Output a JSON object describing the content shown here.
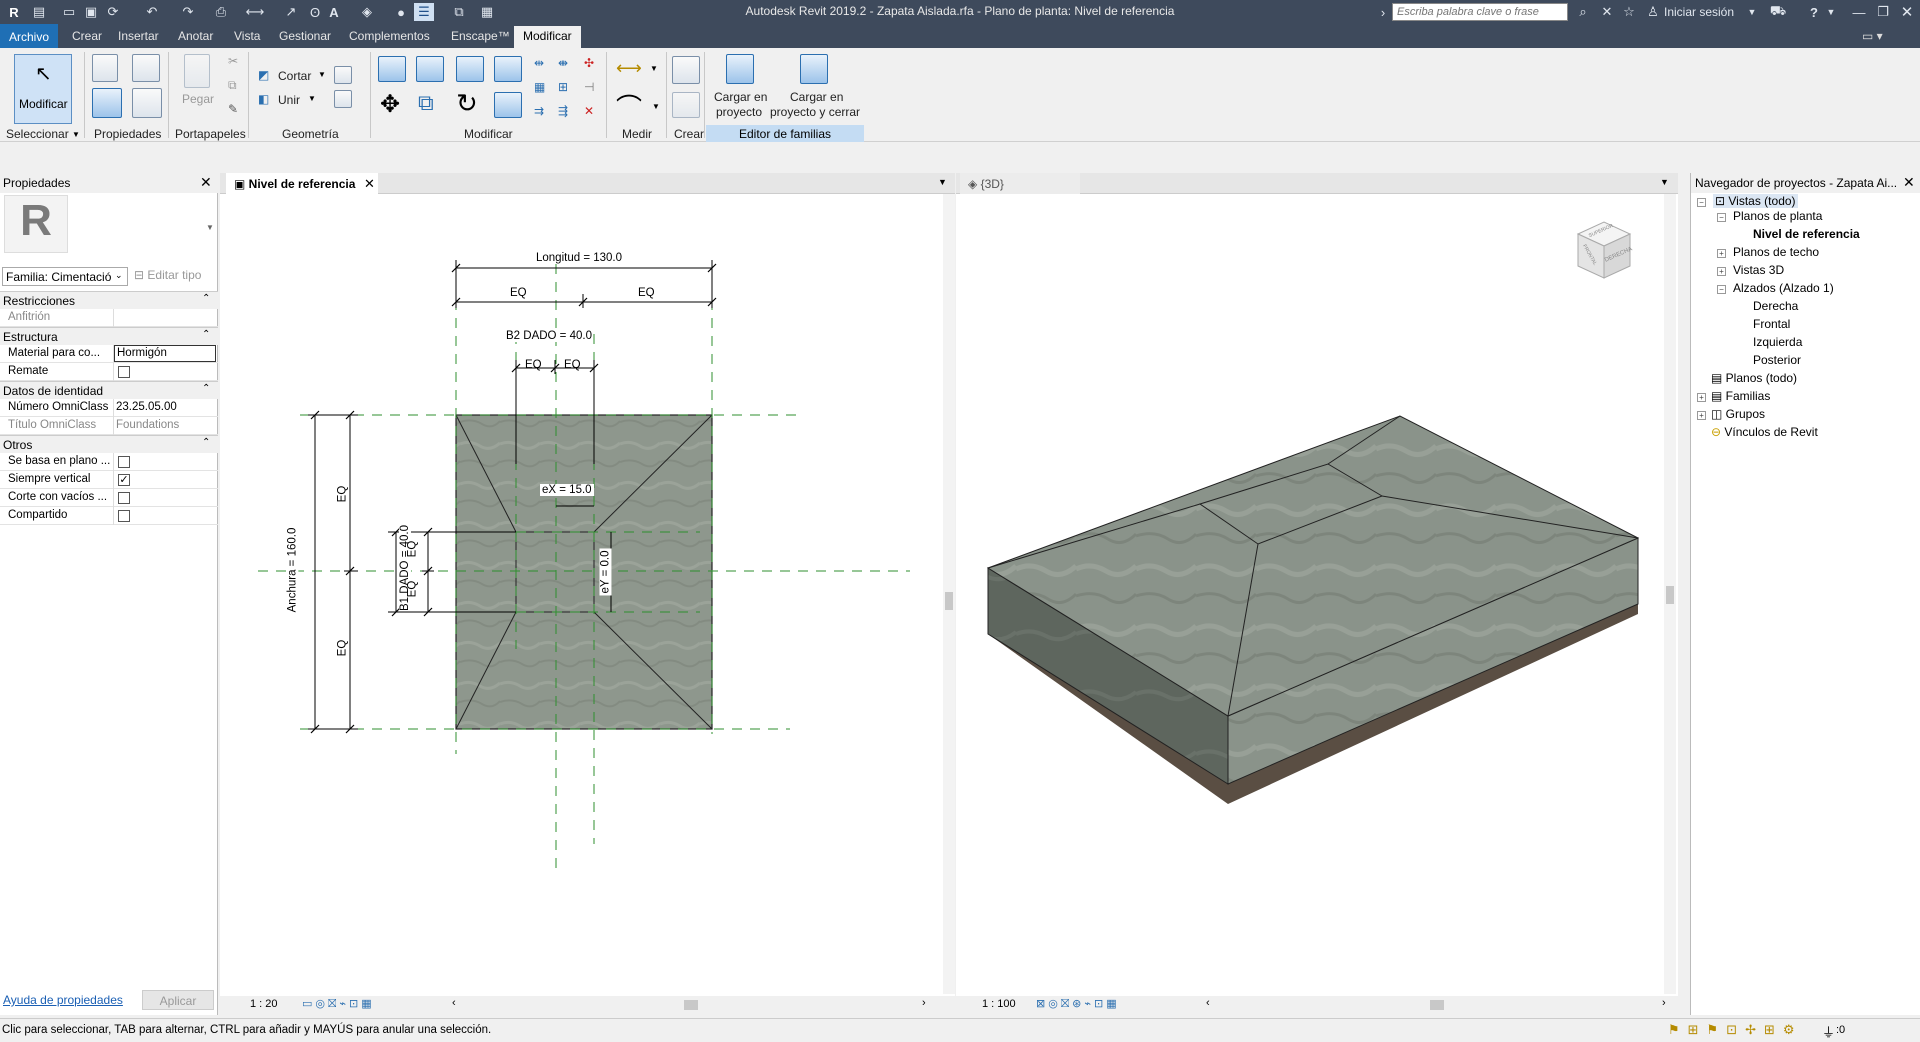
{
  "window": {
    "title": "Autodesk Revit 2019.2 - Zapata Aislada.rfa - Plano de planta: Nivel de referencia"
  },
  "search": {
    "placeholder": "Escriba palabra clave o frase"
  },
  "account": {
    "signin": "Iniciar sesión"
  },
  "menu": {
    "file": "Archivo",
    "items": [
      "Crear",
      "Insertar",
      "Anotar",
      "Vista",
      "Gestionar",
      "Complementos",
      "Enscape™",
      "Modificar"
    ]
  },
  "ribbon": {
    "modify_button": "Modificar",
    "select_label": "Seleccionar",
    "properties_label": "Propiedades",
    "paste_label": "Pegar",
    "clipboard_label": "Portapapeles",
    "cut_label": "Cortar",
    "join_label": "Unir",
    "geometry_label": "Geometría",
    "modify_panel_label": "Modificar",
    "measure_label": "Medir",
    "create_label": "Crear",
    "load_project_1": "Cargar en",
    "load_project_2": "proyecto",
    "load_close_1": "Cargar en",
    "load_close_2": "proyecto y cerrar",
    "family_editor_label": "Editor de familias"
  },
  "properties": {
    "title": "Propiedades",
    "family_selector": "Familia: Cimentació",
    "edit_type": "Editar tipo",
    "groups": [
      {
        "name": "Restricciones",
        "rows": [
          {
            "k": "Anfitrión",
            "v": "",
            "gray": true
          }
        ]
      },
      {
        "name": "Estructura",
        "rows": [
          {
            "k": "Material para co...",
            "v": "Hormigón",
            "boxed": true
          },
          {
            "k": "Remate",
            "v": "",
            "checkbox": false
          }
        ]
      },
      {
        "name": "Datos de identidad",
        "rows": [
          {
            "k": "Número OmniClass",
            "v": "23.25.05.00"
          },
          {
            "k": "Título OmniClass",
            "v": "Foundations",
            "gray": true
          }
        ]
      },
      {
        "name": "Otros",
        "rows": [
          {
            "k": "Se basa en plano ...",
            "checkbox": false
          },
          {
            "k": "Siempre vertical",
            "checkbox": true
          },
          {
            "k": "Corte con vacíos ...",
            "checkbox": false
          },
          {
            "k": "Compartido",
            "checkbox": false
          }
        ]
      }
    ],
    "help_link": "Ayuda de propiedades",
    "apply_button": "Aplicar"
  },
  "view_plan": {
    "tab": "Nivel de referencia",
    "scale": "1 : 20",
    "dims": {
      "longitud": "Longitud = 130.0",
      "eq": "EQ",
      "b2": "B2 DADO = 40.0",
      "anchura": "Anchura = 160.0",
      "b1": "B1 DADO = 40.0",
      "ex": "eX = 15.0",
      "ey": "eY = 0.0"
    }
  },
  "view_3d": {
    "tab": "{3D}",
    "scale": "1 : 100",
    "cube_top": "SUPERIOR",
    "cube_front": "FRONTAL",
    "cube_right": "DERECHA"
  },
  "navigator": {
    "title": "Navegador de proyectos - Zapata Ai...",
    "items": [
      {
        "label": "Vistas (todo)",
        "level": 0,
        "toggle": "-"
      },
      {
        "label": "Planos de planta",
        "level": 1,
        "toggle": "-"
      },
      {
        "label": "Nivel de referencia",
        "level": 2,
        "bold": true
      },
      {
        "label": "Planos de techo",
        "level": 1,
        "toggle": "+"
      },
      {
        "label": "Vistas 3D",
        "level": 1,
        "toggle": "+"
      },
      {
        "label": "Alzados (Alzado 1)",
        "level": 1,
        "toggle": "-"
      },
      {
        "label": "Derecha",
        "level": 2
      },
      {
        "label": "Frontal",
        "level": 2
      },
      {
        "label": "Izquierda",
        "level": 2
      },
      {
        "label": "Posterior",
        "level": 2
      },
      {
        "label": "Planos (todo)",
        "level": 0
      },
      {
        "label": "Familias",
        "level": 0,
        "toggle": "+"
      },
      {
        "label": "Grupos",
        "level": 0,
        "toggle": "+"
      },
      {
        "label": "Vínculos de Revit",
        "level": 0
      }
    ]
  },
  "status": {
    "text": "Clic para seleccionar, TAB para alternar, CTRL para añadir y MAYÚS para anular una selección.",
    "filter_count": ":0"
  },
  "colors": {
    "titlebar": "#3e4a5c",
    "accent": "#1f6fb5",
    "dim_green": "#2f8f2f",
    "concrete": "#8d968d"
  }
}
